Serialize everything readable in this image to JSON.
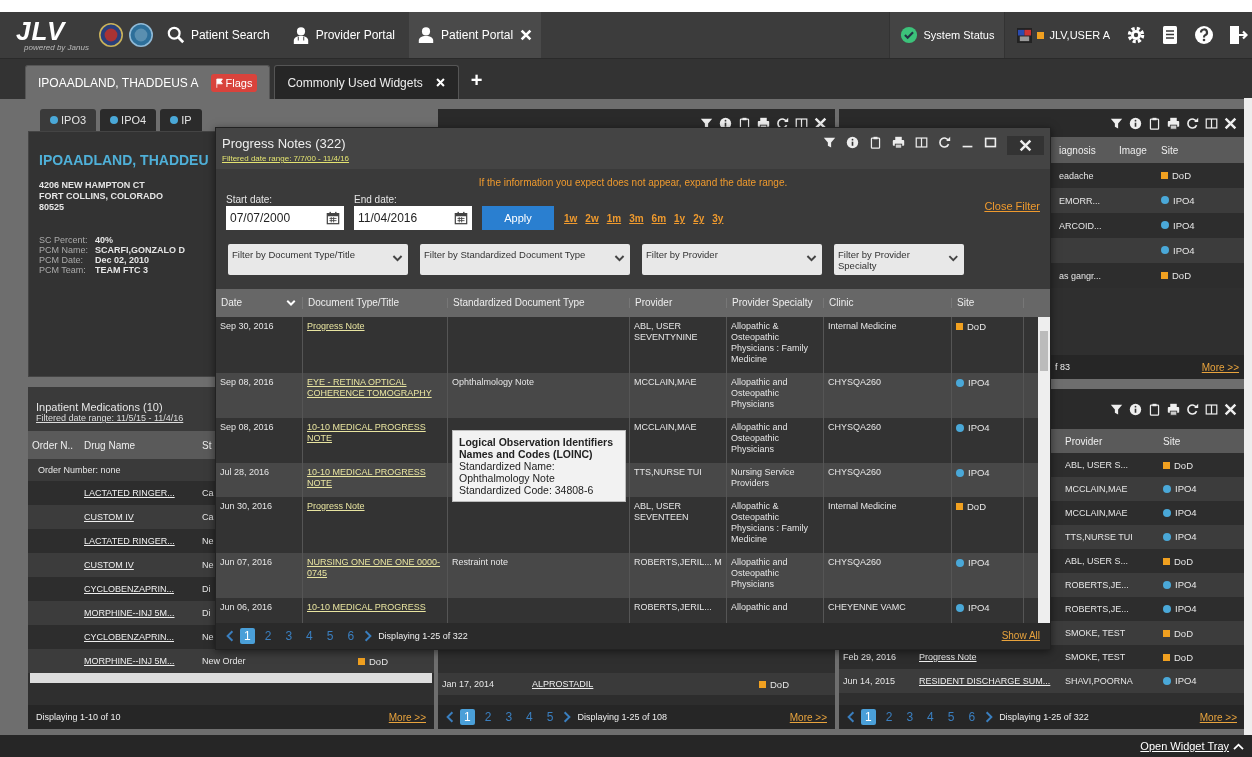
{
  "nav": {
    "logo": "JLV",
    "logo_sub": "powered by Janus",
    "items": [
      {
        "label": "Patient Search",
        "selected": false,
        "closable": false
      },
      {
        "label": "Provider Portal",
        "selected": false,
        "closable": false
      },
      {
        "label": "Patient Portal",
        "selected": true,
        "closable": true
      }
    ],
    "system_status": "System Status",
    "user": "JLV,USER A"
  },
  "patient_tabs": [
    {
      "label": "IPOAADLAND, THADDEUS A",
      "badge": "Flags",
      "selected": true,
      "closable": false
    },
    {
      "label": "Commonly Used Widgets",
      "selected": false,
      "closable": true
    }
  ],
  "add_tab": "+",
  "patient_widget": {
    "site_tabs": [
      {
        "label": "IPO3",
        "selected": true
      },
      {
        "label": "IPO4",
        "selected": false
      },
      {
        "label": "IP",
        "selected": false
      }
    ],
    "name": "IPOAADLAND, THADDEU",
    "address": [
      "4206 NEW HAMPTON CT",
      "FORT COLLINS, COLORADO",
      "80525"
    ],
    "fields": [
      {
        "label": "SC Percent:",
        "value": "40%"
      },
      {
        "label": "PCM Name:",
        "value": "SCARFI,GONZALO D"
      },
      {
        "label": "PCM Date:",
        "value": "Dec 02, 2010"
      },
      {
        "label": "PCM Team:",
        "value": "TEAM FTC 3"
      }
    ]
  },
  "medications": {
    "title": "Inpatient Medications (10)",
    "filter": "Filtered date range: 11/5/15 - 11/4/16",
    "columns": [
      "Order N..",
      "Drug Name",
      "St"
    ],
    "group": "Order Number: none",
    "rows": [
      {
        "drug": "LACTATED RINGER...",
        "status": "Ca",
        "site": null
      },
      {
        "drug": "CUSTOM IV",
        "status": "Ca",
        "site": null
      },
      {
        "drug": "LACTATED RINGER...",
        "status": "Ne",
        "site": null
      },
      {
        "drug": "CUSTOM IV",
        "status": "Ne",
        "site": null
      },
      {
        "drug": "CYCLOBENZAPRIN...",
        "status": "Di",
        "site": null
      },
      {
        "drug": "MORPHINE--INJ 5M...",
        "status": "Di",
        "site": null
      },
      {
        "drug": "CYCLOBENZAPRIN...",
        "status": "Ne",
        "site": null
      },
      {
        "drug": "MORPHINE--INJ 5M...",
        "status": "New Order",
        "site": {
          "label": "DoD",
          "kind": "square"
        }
      }
    ],
    "footer": "Displaying 1-10 of 10",
    "more": "More >>"
  },
  "documents": {
    "rows": [
      {
        "date": "Jan 17, 2014",
        "title": "ALPROSTADIL",
        "site": {
          "label": "DoD",
          "kind": "square"
        }
      }
    ],
    "pages": [
      {
        "label": "1",
        "selected": true
      },
      {
        "label": "2",
        "selected": false
      },
      {
        "label": "3",
        "selected": false
      },
      {
        "label": "4",
        "selected": false
      },
      {
        "label": "5",
        "selected": false
      }
    ],
    "footer": "Displaying 1-25 of 108",
    "more": "More >>"
  },
  "encounters": {
    "columns": [
      "iagnosis",
      "Image",
      "Site"
    ],
    "rows": [
      {
        "diagnosis": "eadache",
        "site": {
          "label": "DoD",
          "kind": "square"
        }
      },
      {
        "diagnosis": "EMORR...",
        "site": {
          "label": "IPO4",
          "kind": "dot"
        }
      },
      {
        "diagnosis": "ARCOID...",
        "site": {
          "label": "IPO4",
          "kind": "dot"
        }
      },
      {
        "diagnosis": "",
        "site": {
          "label": "IPO4",
          "kind": "dot"
        }
      },
      {
        "diagnosis": "as gangr...",
        "site": {
          "label": "DoD",
          "kind": "square"
        }
      }
    ],
    "footer": "f 83",
    "more": "More >>"
  },
  "notes": {
    "columns": [
      "Provider",
      "Site"
    ],
    "rows": [
      {
        "date": "",
        "title": "",
        "provider": "ABL, USER S...",
        "site": {
          "label": "DoD",
          "kind": "square"
        }
      },
      {
        "date": "",
        "title": "",
        "provider": "MCCLAIN,MAE",
        "site": {
          "label": "IPO4",
          "kind": "dot"
        }
      },
      {
        "date": "",
        "title": "",
        "provider": "MCCLAIN,MAE",
        "site": {
          "label": "IPO4",
          "kind": "dot"
        }
      },
      {
        "date": "",
        "title": "",
        "provider": "TTS,NURSE TUI",
        "site": {
          "label": "IPO4",
          "kind": "dot"
        }
      },
      {
        "date": "",
        "title": "",
        "provider": "ABL, USER S...",
        "site": {
          "label": "DoD",
          "kind": "square"
        }
      },
      {
        "date": "",
        "title": "",
        "provider": "ROBERTS,JE...",
        "site": {
          "label": "IPO4",
          "kind": "dot"
        }
      },
      {
        "date": "",
        "title": "",
        "provider": "ROBERTS,JE...",
        "site": {
          "label": "IPO4",
          "kind": "dot"
        }
      },
      {
        "date": "",
        "title": "",
        "provider": "SMOKE, TEST",
        "site": {
          "label": "DoD",
          "kind": "square"
        }
      },
      {
        "date": "Feb 29, 2016",
        "title": "Progress Note",
        "provider": "SMOKE, TEST",
        "site": {
          "label": "DoD",
          "kind": "square"
        }
      },
      {
        "date": "Jun 14, 2015",
        "title": "RESIDENT DISCHARGE SUM...",
        "provider": "SHAVI,POORNA",
        "site": {
          "label": "IPO4",
          "kind": "dot"
        }
      }
    ],
    "pages": [
      {
        "label": "1",
        "selected": true
      },
      {
        "label": "2",
        "selected": false
      },
      {
        "label": "3",
        "selected": false
      },
      {
        "label": "4",
        "selected": false
      },
      {
        "label": "5",
        "selected": false
      },
      {
        "label": "6",
        "selected": false
      }
    ],
    "footer": "Displaying 1-25 of 322",
    "more": "More >>"
  },
  "modal": {
    "title": "Progress Notes (322)",
    "filter": "Filtered date range: 7/7/00 - 11/4/16",
    "message": "If the information you expect does not appear, expand the date range.",
    "start_label": "Start date:",
    "start_value": "07/07/2000",
    "end_label": "End date:",
    "end_value": "11/04/2016",
    "apply": "Apply",
    "quick_ranges": [
      "1w",
      "2w",
      "1m",
      "3m",
      "6m",
      "1y",
      "2y",
      "3y"
    ],
    "close_filter": "Close Filter",
    "dropdowns": [
      "Filter by Document Type/Title",
      "Filter by Standardized Document Type",
      "Filter by Provider",
      "Filter by Provider Specialty"
    ],
    "columns": [
      "Date",
      "Document Type/Title",
      "Standardized Document Type",
      "Provider",
      "Provider Specialty",
      "Clinic",
      "Site"
    ],
    "rows": [
      {
        "date": "Sep 30, 2016",
        "title": "Progress Note",
        "std": "",
        "provider": "ABL, USER SEVENTYNINE",
        "specialty": "Allopathic & Osteopathic Physicians : Family Medicine",
        "clinic": "Internal Medicine",
        "site": {
          "label": "DoD",
          "kind": "square"
        }
      },
      {
        "date": "Sep 08, 2016",
        "title": "EYE - RETINA OPTICAL COHERENCE TOMOGRAPHY",
        "std": "Ophthalmology Note",
        "provider": "MCCLAIN,MAE",
        "specialty": "Allopathic and Osteopathic Physicians",
        "clinic": "CHYSQA260",
        "site": {
          "label": "IPO4",
          "kind": "dot"
        }
      },
      {
        "date": "Sep 08, 2016",
        "title": "10-10 MEDICAL PROGRESS NOTE",
        "std": "",
        "provider": "MCCLAIN,MAE",
        "specialty": "Allopathic and Osteopathic Physicians",
        "clinic": "CHYSQA260",
        "site": {
          "label": "IPO4",
          "kind": "dot"
        }
      },
      {
        "date": "Jul 28, 2016",
        "title": "10-10 MEDICAL PROGRESS NOTE",
        "std": "",
        "provider": "TTS,NURSE TUI",
        "specialty": "Nursing Service Providers",
        "clinic": "CHYSQA260",
        "site": {
          "label": "IPO4",
          "kind": "dot"
        }
      },
      {
        "date": "Jun 30, 2016",
        "title": "Progress Note",
        "std": "",
        "provider": "ABL, USER SEVENTEEN",
        "specialty": "Allopathic & Osteopathic Physicians : Family Medicine",
        "clinic": "Internal Medicine",
        "site": {
          "label": "DoD",
          "kind": "square"
        }
      },
      {
        "date": "Jun 07, 2016",
        "title": "NURSING ONE ONE ONE 0000-0745",
        "std": "Restraint note",
        "provider": "ROBERTS,JERIL... M",
        "specialty": "Allopathic and Osteopathic Physicians",
        "clinic": "CHYSQA260",
        "site": {
          "label": "IPO4",
          "kind": "dot"
        }
      },
      {
        "date": "Jun 06, 2016",
        "title": "10-10 MEDICAL PROGRESS",
        "std": "",
        "provider": "ROBERTS,JERIL...",
        "specialty": "Allopathic and",
        "clinic": "CHEYENNE VAMC",
        "site": {
          "label": "IPO4",
          "kind": "dot"
        }
      }
    ],
    "pages": [
      {
        "label": "1",
        "selected": true
      },
      {
        "label": "2",
        "selected": false
      },
      {
        "label": "3",
        "selected": false
      },
      {
        "label": "4",
        "selected": false
      },
      {
        "label": "5",
        "selected": false
      },
      {
        "label": "6",
        "selected": false
      }
    ],
    "footer": "Displaying 1-25 of 322",
    "show_all": "Show All",
    "tooltip": {
      "title": "Logical Observation Identifiers Names and Codes (LOINC)",
      "lines": [
        "Standardized Name: Ophthalmology Note",
        "Standardized Code: 34808-6"
      ]
    }
  },
  "bottom_bar": {
    "link": "Open Widget Tray"
  }
}
